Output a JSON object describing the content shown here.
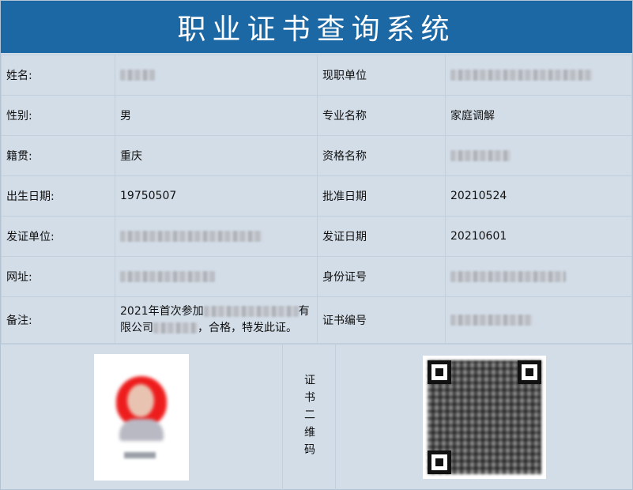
{
  "header": {
    "title": "职业证书查询系统"
  },
  "rows": [
    {
      "left_label": "姓名:",
      "left_value": "",
      "right_label": "现职单位",
      "right_value": ""
    },
    {
      "left_label": "性别:",
      "left_value": "男",
      "right_label": "专业名称",
      "right_value": "家庭调解"
    },
    {
      "left_label": "籍贯:",
      "left_value": "重庆",
      "right_label": "资格名称",
      "right_value": ""
    },
    {
      "left_label": "出生日期:",
      "left_value": "19750507",
      "right_label": "批准日期",
      "right_value": "20210524"
    },
    {
      "left_label": "发证单位:",
      "left_value": "",
      "right_label": "发证日期",
      "right_value": "20210601"
    },
    {
      "left_label": "网址:",
      "left_value": "",
      "right_label": "身份证号",
      "right_value": ""
    },
    {
      "left_label": "备注:",
      "left_value_part1": "2021年首次参加",
      "left_value_part2": "有",
      "left_value_part3": "限公司",
      "left_value_part4": "，合格，特发此证。",
      "right_label": "证书编号",
      "right_value": ""
    }
  ],
  "bottom": {
    "qr_label": "证书二维码"
  }
}
